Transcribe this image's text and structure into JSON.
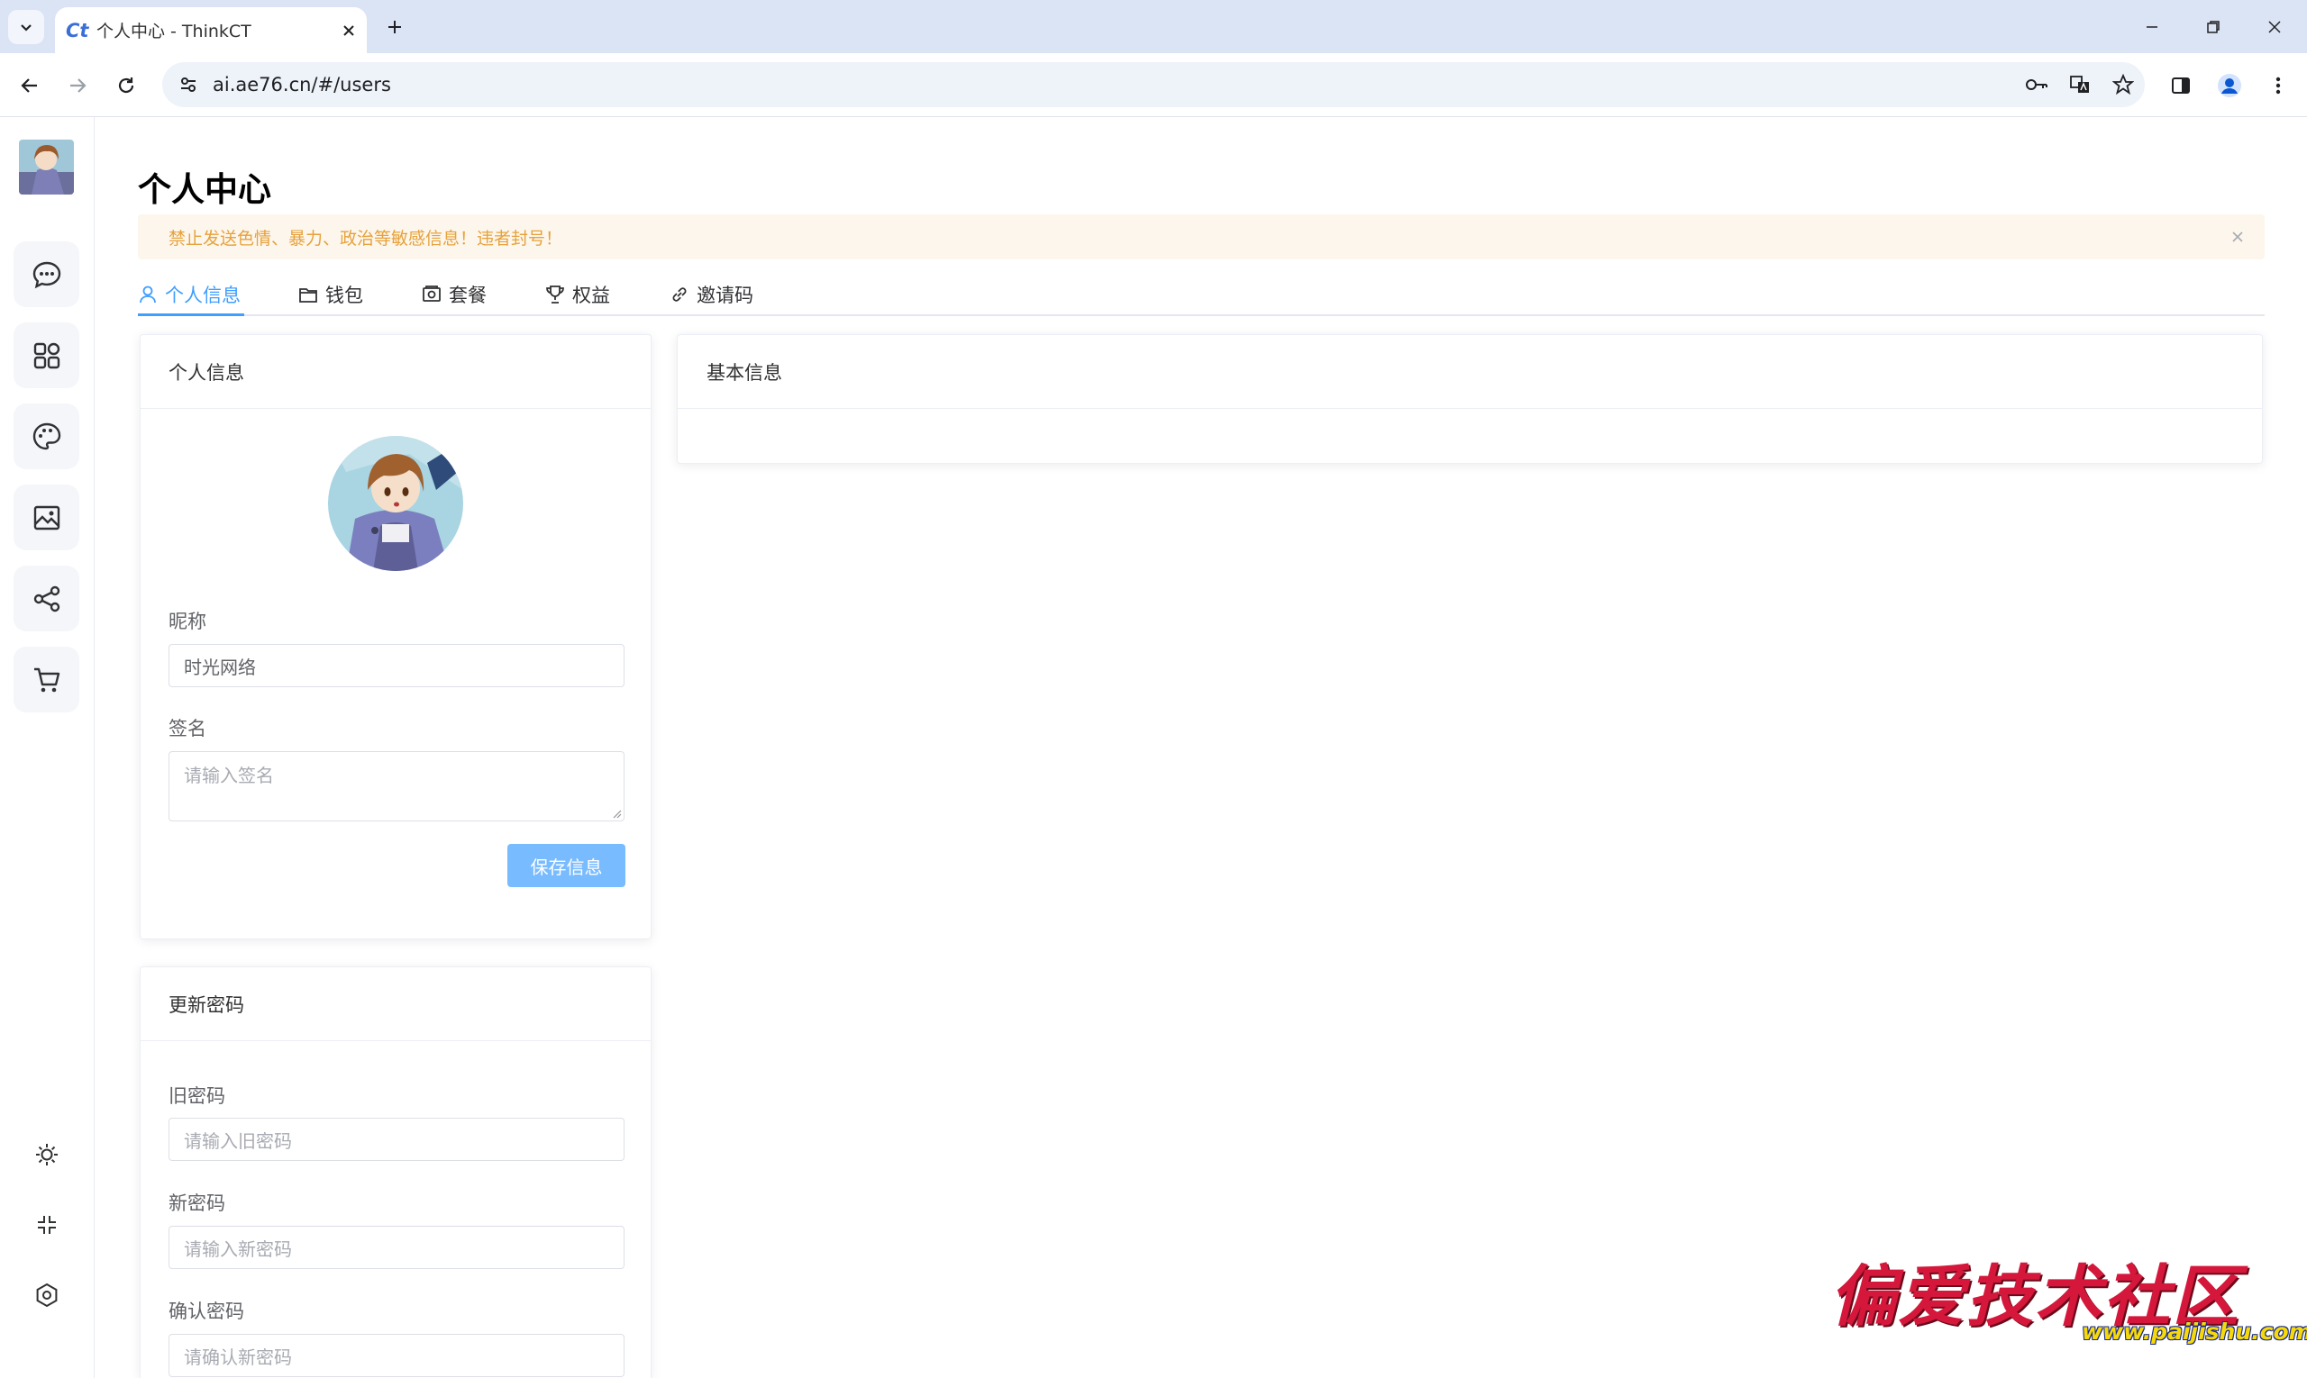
{
  "browser": {
    "tab_title": "个人中心 - ThinkCT",
    "favicon_text": "Ct",
    "url": "ai.ae76.cn/#/users"
  },
  "page": {
    "title": "个人中心",
    "alert": "禁止发送色情、暴力、政治等敏感信息！违者封号！"
  },
  "tabs": [
    {
      "label": "个人信息",
      "icon": "user-icon",
      "active": true
    },
    {
      "label": "钱包",
      "icon": "wallet-icon",
      "active": false
    },
    {
      "label": "套餐",
      "icon": "package-icon",
      "active": false
    },
    {
      "label": "权益",
      "icon": "trophy-icon",
      "active": false
    },
    {
      "label": "邀请码",
      "icon": "link-icon",
      "active": false
    }
  ],
  "profile_card": {
    "title": "个人信息",
    "nickname_label": "昵称",
    "nickname_value": "时光网络",
    "signature_label": "签名",
    "signature_placeholder": "请输入签名",
    "save_label": "保存信息"
  },
  "password_card": {
    "title": "更新密码",
    "old_label": "旧密码",
    "old_placeholder": "请输入旧密码",
    "new_label": "新密码",
    "new_placeholder": "请输入新密码",
    "confirm_label": "确认密码",
    "confirm_placeholder": "请确认新密码"
  },
  "basic_card": {
    "title": "基本信息"
  },
  "sidebar": {
    "items": [
      "chat-icon",
      "apps-icon",
      "palette-icon",
      "image-icon",
      "share-icon",
      "cart-icon"
    ],
    "bottom": [
      "sun-icon",
      "collapse-icon",
      "settings-icon"
    ]
  },
  "watermark": {
    "title": "偏爱技术社区",
    "url": "www.paijishu.com"
  },
  "colors": {
    "primary": "#409eff",
    "primary_light": "#79bbff",
    "alert_bg": "#fdf6ec",
    "alert_text": "#e6a23c"
  }
}
